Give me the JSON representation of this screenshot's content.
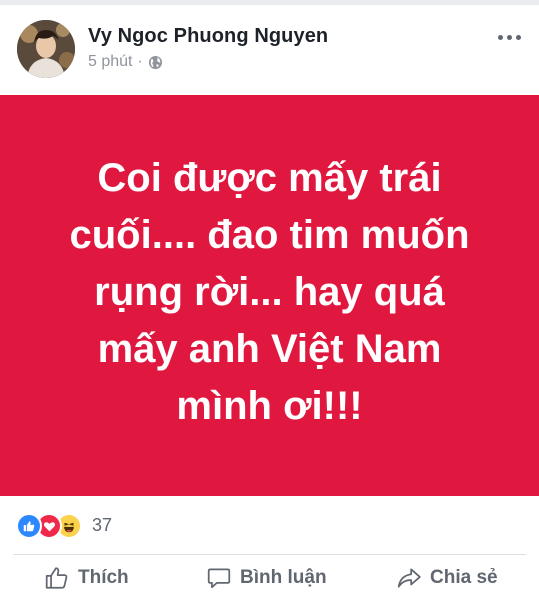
{
  "post": {
    "author": "Vy Ngoc Phuong Nguyen",
    "time": "5 phút",
    "separator": "·",
    "privacy_icon": "globe-icon",
    "body_lines": [
      "Coi được mấy trái",
      "cuối.... đao tim muốn",
      "rụng rời... hay quá",
      "mấy anh Việt Nam",
      "mình ơi!!!"
    ],
    "background_color": "#e0173f"
  },
  "reactions": {
    "icons": [
      "like-reaction-icon",
      "love-reaction-icon",
      "haha-reaction-icon"
    ],
    "count": "37"
  },
  "actions": {
    "like_label": "Thích",
    "comment_label": "Bình luận",
    "share_label": "Chia sẻ"
  }
}
